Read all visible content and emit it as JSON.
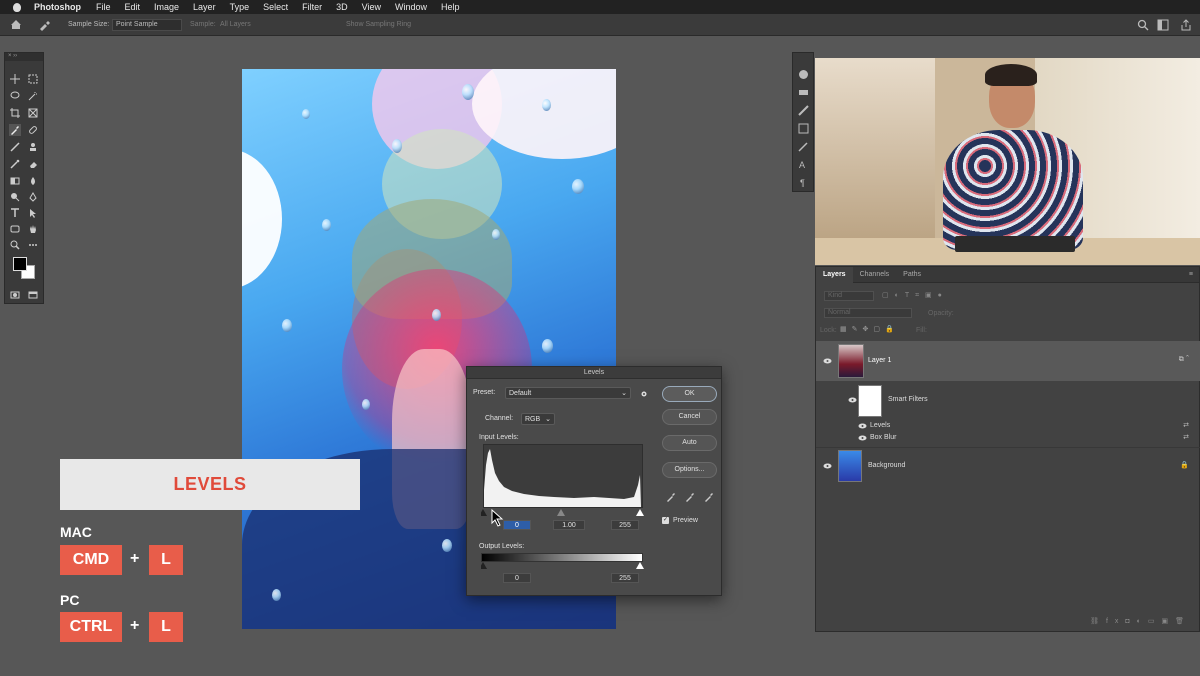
{
  "menubar": {
    "app": "Photoshop",
    "items": [
      "File",
      "Edit",
      "Image",
      "Layer",
      "Type",
      "Select",
      "Filter",
      "3D",
      "View",
      "Window",
      "Help"
    ]
  },
  "options_bar": {
    "sample_size_label": "Sample Size:",
    "sample_size_value": "Point Sample",
    "sample_label": "Sample:",
    "sample_value": "All Layers",
    "show_ring": "Show Sampling Ring"
  },
  "overlay": {
    "banner": "LEVELS",
    "mac_label": "MAC",
    "mac_keys": [
      "CMD",
      "L"
    ],
    "pc_label": "PC",
    "pc_keys": [
      "CTRL",
      "L"
    ],
    "plus": "+"
  },
  "levels_dialog": {
    "title": "Levels",
    "preset_label": "Preset:",
    "preset_value": "Default",
    "channel_label": "Channel:",
    "channel_value": "RGB",
    "input_levels_label": "Input Levels:",
    "input_values": [
      "0",
      "1.00",
      "255"
    ],
    "output_levels_label": "Output Levels:",
    "output_values": [
      "0",
      "255"
    ],
    "buttons": {
      "ok": "OK",
      "cancel": "Cancel",
      "auto": "Auto",
      "options": "Options..."
    },
    "preview_label": "Preview",
    "preview_checked": true
  },
  "layers_panel": {
    "tabs": [
      "Layers",
      "Channels",
      "Paths"
    ],
    "kind_placeholder": "Kind",
    "blend_mode": "Normal",
    "opacity_label": "Opacity:",
    "lock_label": "Lock:",
    "fill_label": "Fill:",
    "layers": [
      {
        "name": "Layer 1",
        "selected": true
      },
      {
        "name": "Smart Filters",
        "filters": [
          "Levels",
          "Box Blur"
        ]
      },
      {
        "name": "Background",
        "locked": true
      }
    ]
  },
  "colors": {
    "accent_red": "#e85d4a",
    "banner_text": "#e04a3a",
    "panel_bg": "#424242"
  }
}
